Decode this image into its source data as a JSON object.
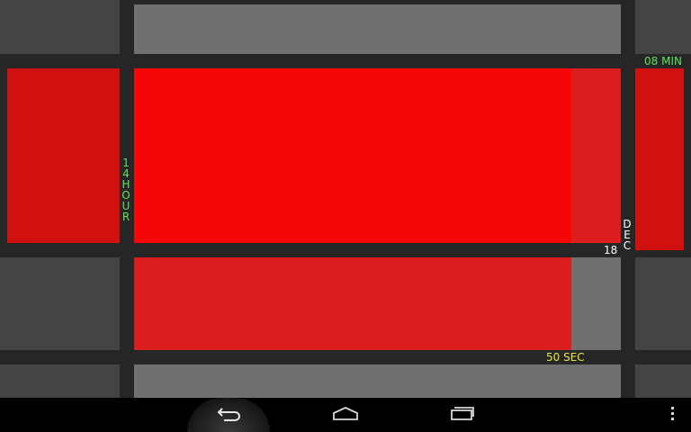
{
  "clock": {
    "minute_label": "08 MIN",
    "hour_label": "14 HOUR",
    "day_label": "18",
    "month_label": "DEC",
    "second_label": "50 SEC"
  },
  "colors": {
    "background": "#262626",
    "tile_gray": "#707070",
    "tile_dark": "#444444",
    "red_bright": "#f60606",
    "red": "#dc1d1d",
    "red_dark": "#d0110f",
    "text_green": "#5ee05e",
    "text_yellow": "#e8e83a",
    "text_white": "#ffffff"
  },
  "navbar": {
    "back_icon": "back-icon",
    "home_icon": "home-icon",
    "recents_icon": "recent-apps-icon",
    "menu_icon": "overflow-menu-icon"
  }
}
